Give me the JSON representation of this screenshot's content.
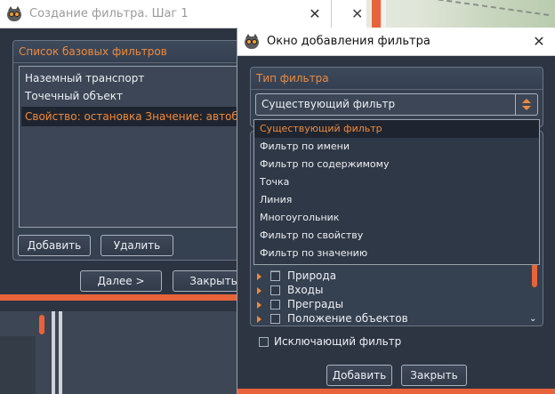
{
  "window1": {
    "title": "Создание фильтра. Шаг 1",
    "close_glyph": "✕",
    "panel_title": "Список базовых фильтров",
    "list": [
      {
        "label": "Наземный транспорт",
        "selected": false
      },
      {
        "label": "Точечный объект",
        "selected": false
      },
      {
        "label": "Свойство: остановка Значение: автобус",
        "selected": true
      }
    ],
    "add_button": "Добавить",
    "delete_button": "Удалить",
    "next_button": "Далее >",
    "close_button": "Закрыть"
  },
  "window2": {
    "close_glyph": "✕"
  },
  "window3": {
    "title": "Окно добавления фильтра",
    "close_glyph": "✕",
    "panel_title": "Тип фильтра",
    "combo_value": "Существующий фильтр",
    "dropdown_options": [
      "Существующий фильтр",
      "Фильтр по имени",
      "Фильтр по содержимому",
      "Точка",
      "Линия",
      "Многоугольник",
      "Фильтр по свойству",
      "Фильтр по значению"
    ],
    "tree_items": [
      "Природа",
      "Входы",
      "Преграды",
      "Положение объектов"
    ],
    "exclusive_checkbox": "Исключающий фильтр",
    "add_button": "Добавить",
    "close_button": "Закрыть"
  },
  "colors": {
    "accent_orange": "#f08a3c",
    "bar_orange": "#e8633a",
    "panel_bg": "#354050",
    "window_bg": "#2c3442"
  }
}
